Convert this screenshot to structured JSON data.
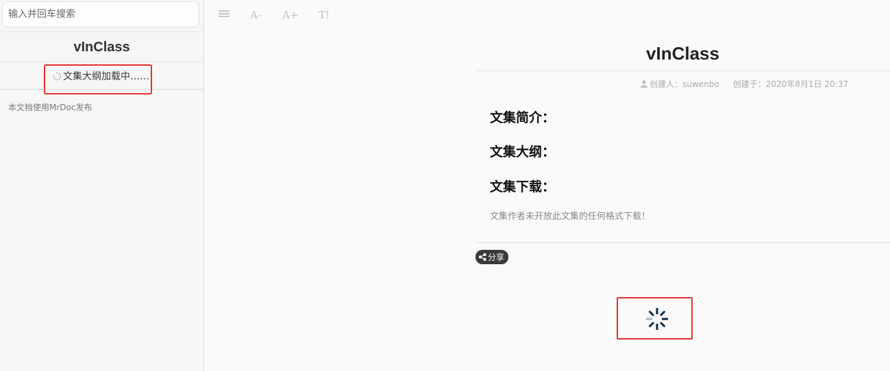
{
  "sidebar": {
    "search_placeholder": "输入并回车搜索",
    "title": "vInClass",
    "toc_loading": "文集大纲加载中……",
    "footer_note": "本文档使用MrDoc发布"
  },
  "toolbar": {
    "menu_icon": "menu-icon",
    "font_decrease": "A-",
    "font_increase": "A+",
    "font_style": "T!"
  },
  "doc": {
    "title": "vInClass",
    "meta": {
      "creator": "创建人：suwenbo",
      "created": "创建于：2020年8月1日 20:37"
    },
    "sections": {
      "intro": "文集简介：",
      "outline": "文集大纲：",
      "download": "文集下载："
    },
    "download_note": "文集作者未开放此文集的任何格式下载！",
    "share": "分享"
  },
  "colors": {
    "highlight_border": "#e3302c",
    "spinner": "#0d2a45"
  }
}
